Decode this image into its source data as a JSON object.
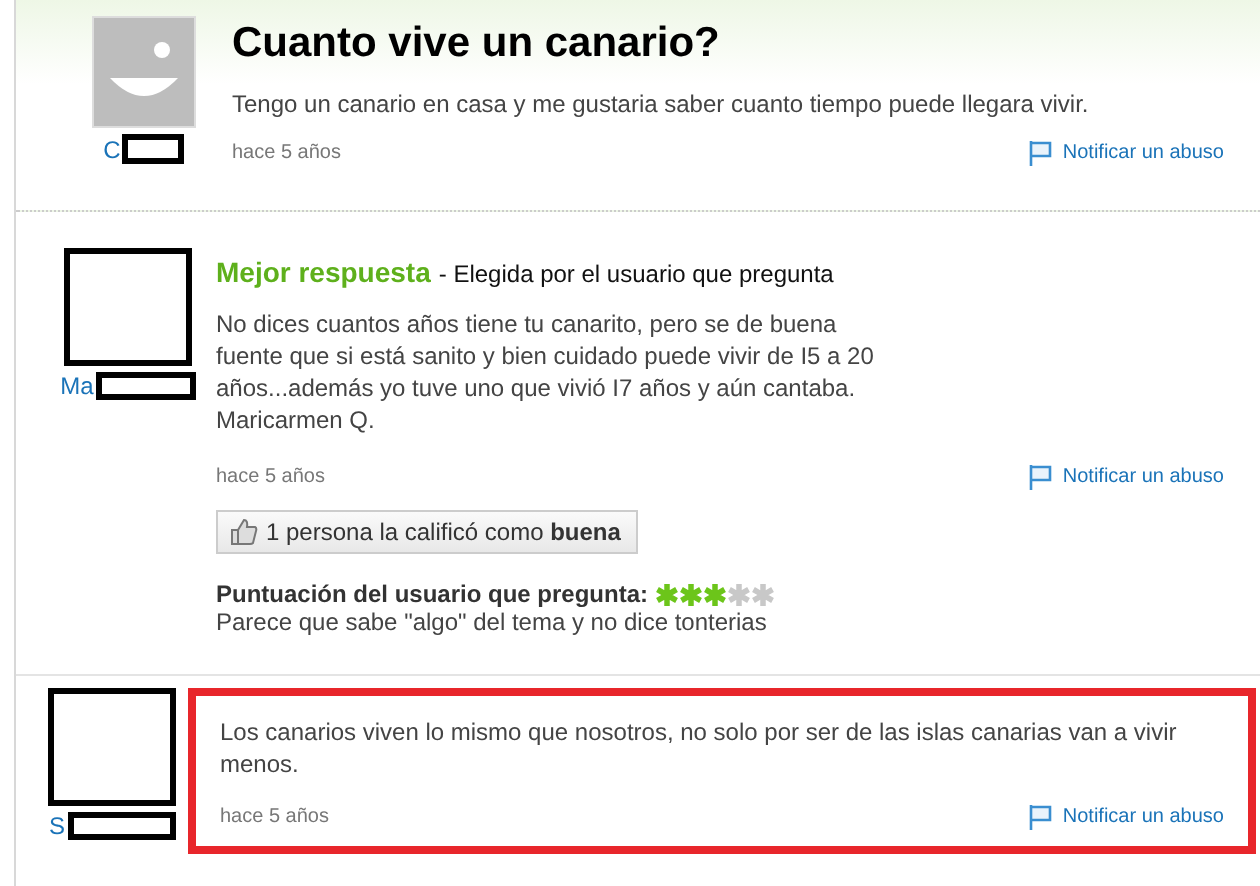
{
  "question": {
    "author": "C",
    "title": "Cuanto vive un canario?",
    "body": "Tengo un canario en casa y me gustaria saber cuanto tiempo puede llegara vivir.",
    "time": "hace 5 años",
    "report": "Notificar un abuso"
  },
  "best_answer": {
    "author": "Ma",
    "label": "Mejor respuesta",
    "chosen_by": "- Elegida por el usuario que pregunta",
    "body": "No dices cuantos años tiene tu canarito, pero se de buena fuente que si está sanito y bien cuidado puede vivir de I5 a 20 años...además yo tuve uno que vivió I7 años y aún cantaba. Maricarmen Q.",
    "time": "hace 5 años",
    "report": "Notificar un abuso",
    "rating_button": "1 persona la calificó como **buena**",
    "asker_rating_label": "Puntuación del usuario que pregunta:",
    "stars": 3,
    "comment": "Parece que sabe \"algo\" del tema y no dice tonterias"
  },
  "answers": [
    {
      "author": "S",
      "body": "Los canarios viven lo mismo que nosotros, no solo por ser de las islas canarias van a vivir menos.",
      "time": "hace 5 años",
      "report": "Notificar un abuso",
      "highlighted": true
    }
  ]
}
